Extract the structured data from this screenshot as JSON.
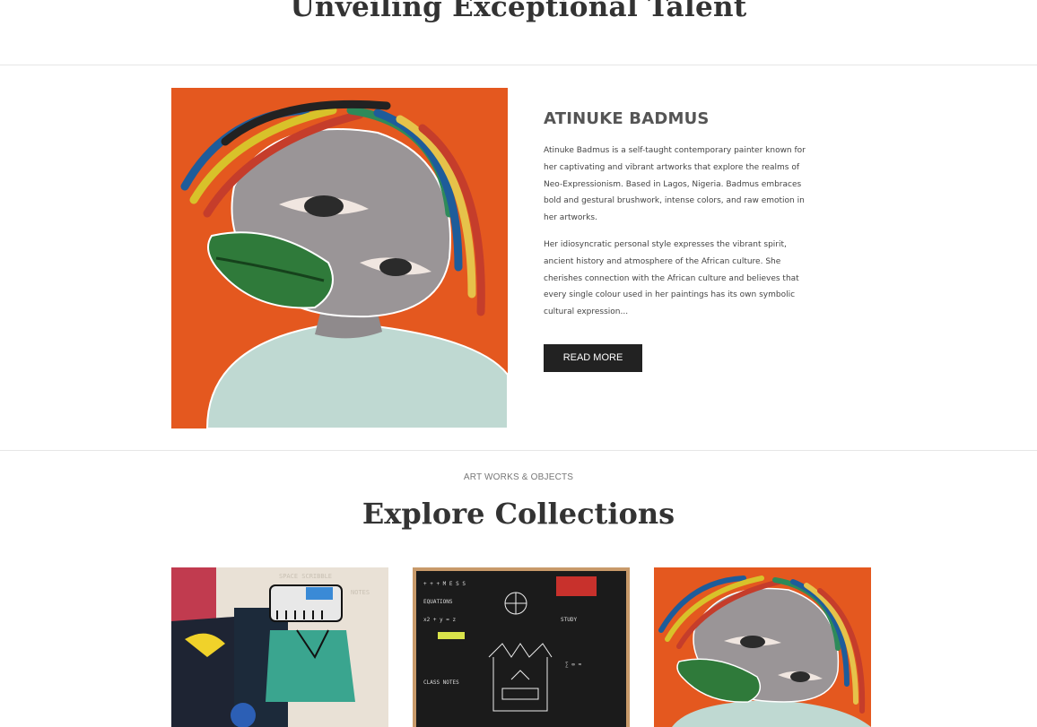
{
  "hero": {
    "title": "Unveiling Exceptional Talent"
  },
  "artist": {
    "name": "ATINUKE BADMUS",
    "paragraphs": [
      "Atinuke Badmus is a self-taught contemporary painter known for her captivating and vibrant artworks that explore the realms of Neo-Expressionism. Based in Lagos, Nigeria. Badmus embraces bold and gestural brushwork, intense colors, and raw emotion in her artworks.",
      "Her idiosyncratic personal style expresses the vibrant spirit, ancient history and atmosphere of the African culture. She cherishes connection with the African culture and believes that every single colour used in her paintings has its own symbolic cultural expression..."
    ],
    "read_more_label": "READ MORE",
    "image_icon": "portrait-painting"
  },
  "collections": {
    "eyebrow": "ART WORKS & OBJECTS",
    "title": "Explore Collections",
    "items": [
      {
        "icon": "graffiti-painting"
      },
      {
        "icon": "chalkboard-painting"
      },
      {
        "icon": "portrait-painting"
      }
    ]
  },
  "colors": {
    "accent_orange": "#e4581f",
    "button_bg": "#222222",
    "divider": "#e6e6e6"
  }
}
